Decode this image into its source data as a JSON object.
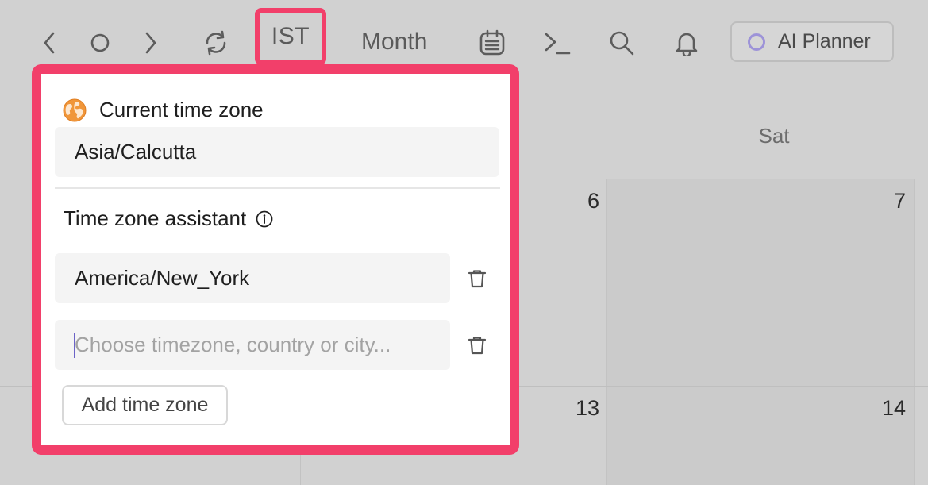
{
  "toolbar": {
    "timezone_label": "IST",
    "view_label": "Month",
    "ai_planner_label": "AI Planner"
  },
  "calendar": {
    "day_header": "Sat",
    "dates": {
      "row1_col_a": "6",
      "row1_col_b": "7",
      "row2_col_a": "13",
      "row2_col_b": "14"
    }
  },
  "popover": {
    "current_section_title": "Current time zone",
    "current_timezone": "Asia/Calcutta",
    "assistant_section_title": "Time zone assistant",
    "assistant_timezones": [
      "America/New_York"
    ],
    "new_timezone_placeholder": "Choose timezone, country or city...",
    "add_button_label": "Add time zone"
  },
  "colors": {
    "highlight": "#f23f6a",
    "background": "#d1d1d1",
    "globe": "#f0963a",
    "caret": "#6b63c7"
  }
}
